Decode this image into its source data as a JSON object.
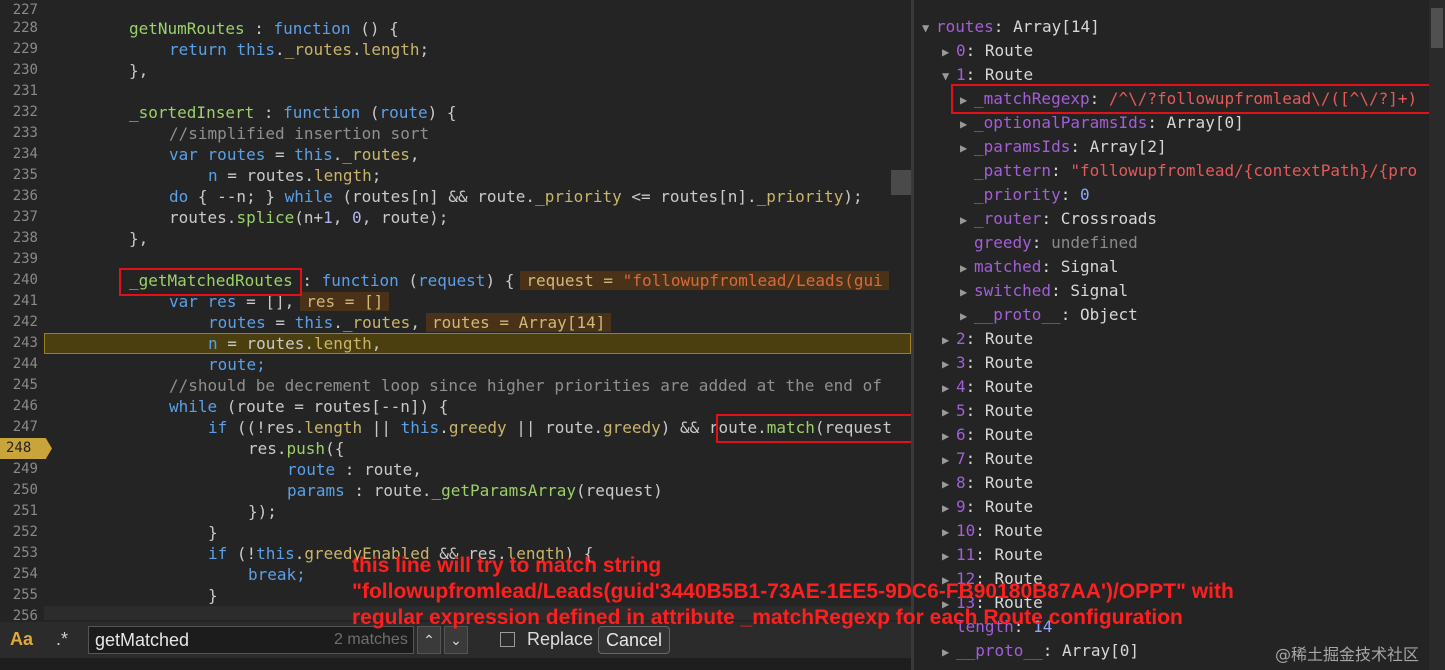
{
  "code": {
    "lines": [
      {
        "num": "227"
      },
      {
        "num": "228",
        "text": "getNumRoutes : function () {"
      },
      {
        "num": "229",
        "text": "return this._routes.length;"
      },
      {
        "num": "230",
        "text": "},"
      },
      {
        "num": "231"
      },
      {
        "num": "232",
        "text": "_sortedInsert : function (route) {"
      },
      {
        "num": "233",
        "text": "//simplified insertion sort"
      },
      {
        "num": "234",
        "text": "var routes = this._routes,"
      },
      {
        "num": "235",
        "text": "n = routes.length;"
      },
      {
        "num": "236",
        "text": "do { --n; } while (routes[n] && route._priority <= routes[n]._priority);"
      },
      {
        "num": "237",
        "text": "routes.splice(n+1, 0, route);"
      },
      {
        "num": "238",
        "text": "},"
      },
      {
        "num": "239"
      },
      {
        "num": "240",
        "text": "_getMatchedRoutes : function (request) {",
        "inline": "request = \"followupfromlead/Leads(gui"
      },
      {
        "num": "241",
        "text": "var res = [],",
        "inline": "res = []"
      },
      {
        "num": "242",
        "text": "routes = this._routes,",
        "inline": "routes = Array[14]"
      },
      {
        "num": "243",
        "text": "n = routes.length,"
      },
      {
        "num": "244",
        "text": "route;"
      },
      {
        "num": "245",
        "text": "//should be decrement loop since higher priorities are added at the end of"
      },
      {
        "num": "246",
        "text": "while (route = routes[--n]) {"
      },
      {
        "num": "247",
        "text": "if ((!res.length || this.greedy || route.greedy) && route.match(request"
      },
      {
        "num": "248",
        "text": "res.push({"
      },
      {
        "num": "249",
        "text": "route : route,"
      },
      {
        "num": "250",
        "text": "params : route._getParamsArray(request)"
      },
      {
        "num": "251",
        "text": "});"
      },
      {
        "num": "252",
        "text": "}"
      },
      {
        "num": "253",
        "text": "if (!this.greedyEnabled && res.length) {"
      },
      {
        "num": "254",
        "text": "break;"
      },
      {
        "num": "255",
        "text": "}"
      },
      {
        "num": "256"
      }
    ]
  },
  "annotation": {
    "line1": "this line will try to match string",
    "line2": "\"followupfromlead/Leads(guid'3440B5B1-73AE-1EE5-9DC6-FB90180B87AA')/OPPT\" with",
    "line3": "regular expression defined in attribute _matchRegexp for each Route configuration"
  },
  "search": {
    "case_label": "Aa",
    "regex_label": ".*",
    "query": "getMatched",
    "match_count": "2 matches",
    "prev_glyph": "⌃",
    "next_glyph": "⌄",
    "replace_label": "Replace",
    "cancel_label": "Cancel"
  },
  "scope": {
    "root": {
      "key": "routes",
      "value": "Array[14]"
    },
    "route_label": "Route",
    "route1_props": [
      {
        "key": "_matchRegexp",
        "value": "/^\\/?followupfromlead\\/([^\\/?]+)"
      },
      {
        "key": "_optionalParamsIds",
        "value": "Array[0]"
      },
      {
        "key": "_paramsIds",
        "value": "Array[2]"
      },
      {
        "key": "_pattern",
        "value": "\"followupfromlead/{contextPath}/{pro"
      },
      {
        "key": "_priority",
        "value": "0"
      },
      {
        "key": "_router",
        "value": "Crossroads"
      },
      {
        "key": "greedy",
        "value": "undefined"
      },
      {
        "key": "matched",
        "value": "Signal"
      },
      {
        "key": "switched",
        "value": "Signal"
      },
      {
        "key": "__proto__",
        "value": "Object"
      }
    ],
    "indices": [
      "0",
      "1",
      "2",
      "3",
      "4",
      "5",
      "6",
      "7",
      "8",
      "9",
      "10",
      "11",
      "12",
      "13"
    ],
    "length": {
      "key": "length",
      "value": "14"
    },
    "proto": {
      "key": "__proto__",
      "value": "Array[0]"
    }
  },
  "watermark": "@稀土掘金技术社区",
  "colors": {
    "annotation": "#ff1f1f",
    "highlight_box": "#e3101a",
    "breakpoint": "#c8a43a"
  }
}
